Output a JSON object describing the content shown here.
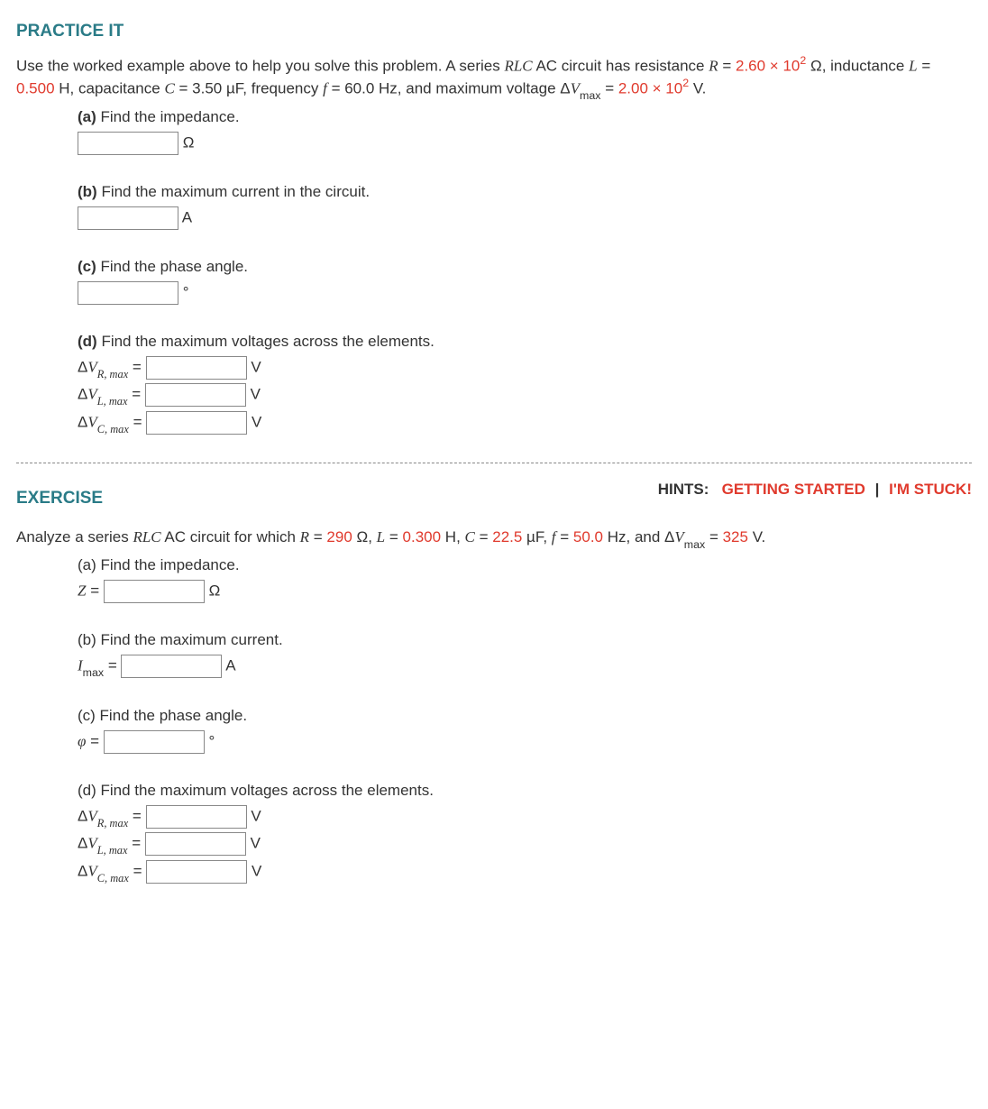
{
  "practice": {
    "title": "PRACTICE IT",
    "intro_pre": "Use the worked example above to help you solve this problem. A series ",
    "intro_rlc": "RLC",
    "intro_post": " AC circuit has resistance ",
    "R_sym": "R",
    "eq": " = ",
    "R_val": "2.60 × 10",
    "R_exp": "2",
    "ohm": " Ω, inductance ",
    "L_sym": "L",
    "L_val": "0.500",
    "H": " H, capacitance ",
    "C_sym": "C",
    "C_val": " = 3.50 µF, frequency ",
    "f_sym": "f",
    "f_val": " = 60.0 Hz, and maximum voltage Δ",
    "V_sym": "V",
    "max": "max",
    "Vmax_val": "2.00 × 10",
    "Vmax_exp": "2",
    "Vmax_unit": " V.",
    "a": {
      "label": "(a)",
      "text": " Find the impedance.",
      "unit": "Ω"
    },
    "b": {
      "label": "(b)",
      "text": " Find the maximum current in the circuit.",
      "unit": "A"
    },
    "c": {
      "label": "(c)",
      "text": " Find the phase angle.",
      "unit": "°"
    },
    "d": {
      "label": "(d)",
      "text": " Find the maximum voltages across the elements.",
      "rows": [
        {
          "sym": "Δ",
          "var": "V",
          "sub": "R, max",
          "eq": " = ",
          "unit": "V"
        },
        {
          "sym": "Δ",
          "var": "V",
          "sub": "L, max",
          "eq": " = ",
          "unit": "V"
        },
        {
          "sym": "Δ",
          "var": "V",
          "sub": "C, max",
          "eq": " = ",
          "unit": "V"
        }
      ]
    }
  },
  "exercise": {
    "title": "EXERCISE",
    "hints_label": "HINTS:",
    "getting_started": "GETTING STARTED",
    "sep": "|",
    "im_stuck": "I'M STUCK!",
    "intro_pre": "Analyze a series ",
    "intro_rlc": "RLC",
    "intro_post": " AC circuit for which ",
    "R_sym": "R",
    "eq": " = ",
    "R_val": "290",
    "ohm": " Ω, ",
    "L_sym": "L",
    "L_val": "0.300",
    "H": " H, ",
    "C_sym": "C",
    "C_val": "22.5",
    "uF": " µF, ",
    "f_sym": "f",
    "f_val": "50.0",
    "Hz": " Hz, and Δ",
    "V_sym": "V",
    "max": "max",
    "Vmax_val": "325",
    "Vmax_unit": " V.",
    "a": {
      "label": "(a)",
      "text": " Find the impedance.",
      "pre": "Z",
      "eq": " = ",
      "unit": "Ω"
    },
    "b": {
      "label": "(b)",
      "text": " Find the maximum current.",
      "pre": "I",
      "sub": "max",
      "eq": " = ",
      "unit": "A"
    },
    "c": {
      "label": "(c)",
      "text": " Find the phase angle.",
      "pre": "φ",
      "eq": " = ",
      "unit": "°"
    },
    "d": {
      "label": "(d)",
      "text": " Find the maximum voltages across the elements.",
      "rows": [
        {
          "sym": "Δ",
          "var": "V",
          "sub": "R, max",
          "eq": " = ",
          "unit": "V"
        },
        {
          "sym": "Δ",
          "var": "V",
          "sub": "L, max",
          "eq": " = ",
          "unit": "V"
        },
        {
          "sym": "Δ",
          "var": "V",
          "sub": "C, max",
          "eq": " = ",
          "unit": "V"
        }
      ]
    }
  }
}
